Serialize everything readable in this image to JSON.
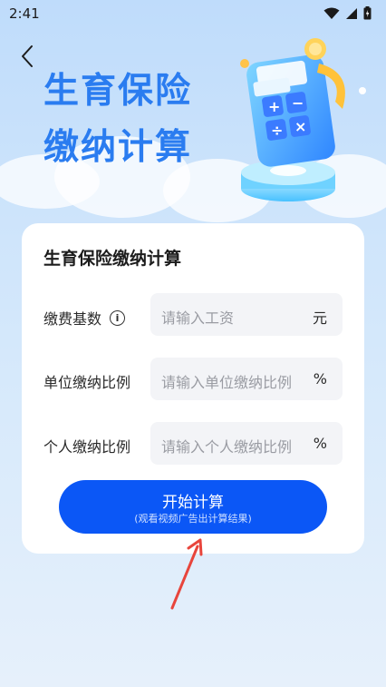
{
  "status_bar": {
    "time": "2:41",
    "icons": [
      "wifi-icon",
      "signal-icon",
      "battery-icon"
    ]
  },
  "nav": {
    "back_icon": "chevron-left-icon"
  },
  "hero": {
    "title_line1": "生育保险",
    "title_line2": "缴纳计算"
  },
  "form": {
    "title": "生育保险缴纳计算",
    "rows": [
      {
        "label": "缴费基数",
        "placeholder": "请输入工资",
        "unit": "元",
        "has_info_icon": true
      },
      {
        "label": "单位缴纳比例",
        "placeholder": "请输入单位缴纳比例",
        "unit": "%"
      },
      {
        "label": "个人缴纳比例",
        "placeholder": "请输入个人缴纳比例",
        "unit": "%"
      }
    ],
    "submit_label": "开始计算",
    "submit_sublabel": "(观看视频广告出计算结果)"
  },
  "colors": {
    "accent": "#0b57f6",
    "title_blue": "#2a7cf0",
    "annotation_arrow": "#e8453c"
  }
}
